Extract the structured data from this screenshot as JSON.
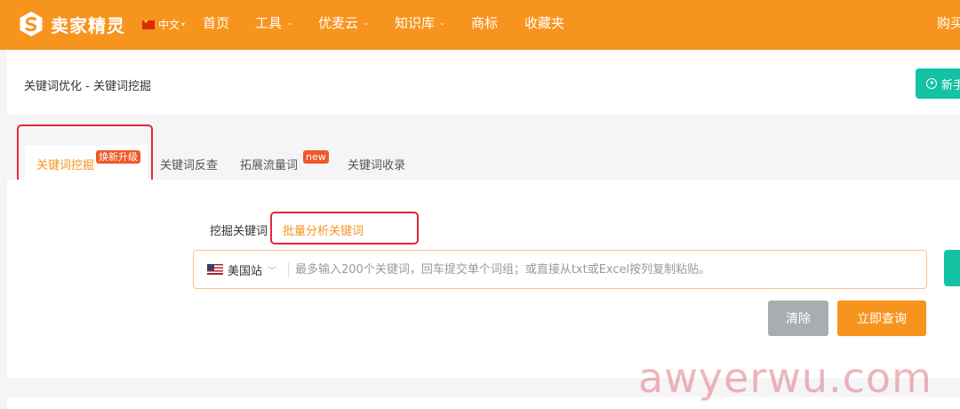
{
  "header": {
    "logo_text": "卖家精灵",
    "language": "中文",
    "nav": [
      {
        "label": "首页",
        "has_dropdown": false
      },
      {
        "label": "工具",
        "has_dropdown": true
      },
      {
        "label": "优麦云",
        "has_dropdown": true
      },
      {
        "label": "知识库",
        "has_dropdown": true
      },
      {
        "label": "商标",
        "has_dropdown": false
      },
      {
        "label": "收藏夹",
        "has_dropdown": false
      }
    ],
    "right_link": "购买",
    "background_color": "#f7941d"
  },
  "breadcrumb": "关键词优化 - 关键词挖掘",
  "guide_button": {
    "label": "新手",
    "icon": "play-circle-icon",
    "color": "#13c2a3"
  },
  "tabs": [
    {
      "label": "关键词挖掘",
      "badge": "焕新升级",
      "active": true
    },
    {
      "label": "关键词反查",
      "badge": null,
      "active": false
    },
    {
      "label": "拓展流量词",
      "badge": "new",
      "active": false
    },
    {
      "label": "关键词收录",
      "badge": null,
      "active": false
    }
  ],
  "subtabs": [
    {
      "label": "挖掘关键词",
      "active": false
    },
    {
      "label": "批量分析关键词",
      "active": true
    }
  ],
  "search": {
    "marketplace": "美国站",
    "placeholder": "最多输入200个关键词，回车提交单个词组；或直接从txt或Excel按列复制粘贴。"
  },
  "buttons": {
    "clear": "清除",
    "query": "立即查询"
  },
  "watermark": "awyerwu.com",
  "colors": {
    "accent": "#f7941d",
    "highlight_box": "#e0283c",
    "badge": "#f0582a",
    "clear_button": "#a9adb2",
    "teal": "#13c2a3"
  }
}
